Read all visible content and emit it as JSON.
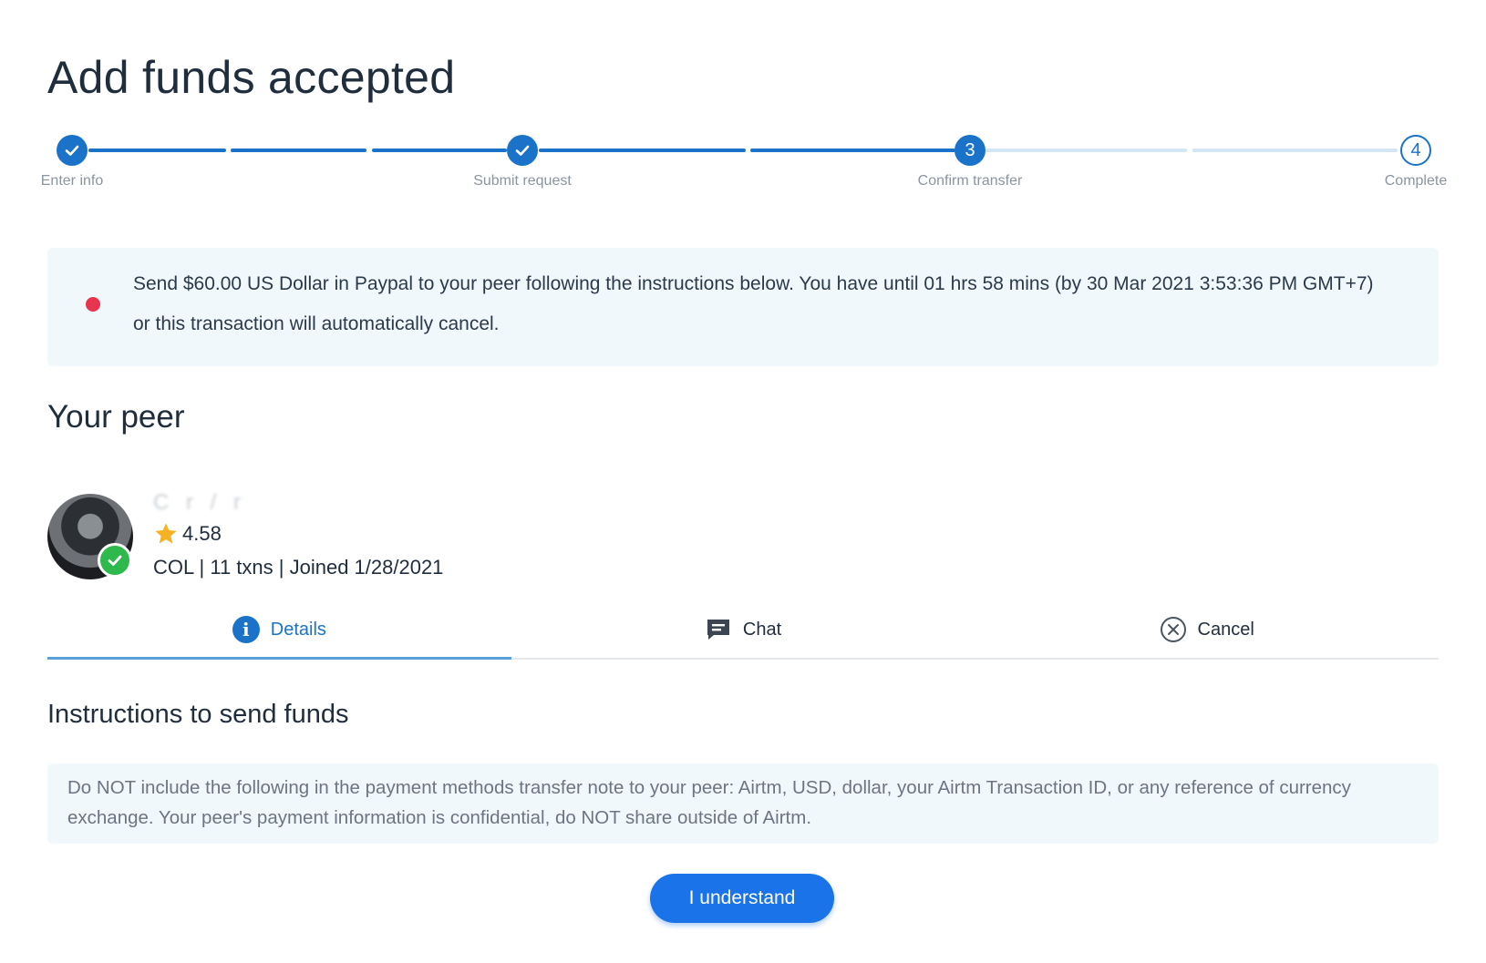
{
  "page": {
    "title": "Add funds accepted"
  },
  "stepper": {
    "steps": [
      {
        "label": "Enter info",
        "status": "done"
      },
      {
        "label": "Submit request",
        "status": "done"
      },
      {
        "label": "Confirm transfer",
        "status": "current",
        "number": "3"
      },
      {
        "label": "Complete",
        "status": "pending",
        "number": "4"
      }
    ]
  },
  "alert": {
    "text": "Send $60.00 US Dollar in Paypal to your peer following the instructions below. You have until 01 hrs 58 mins (by 30 Mar 2021 3:53:36 PM GMT+7) or this transaction will automatically cancel."
  },
  "peer": {
    "section_title": "Your peer",
    "name_redacted": "C r  / r ",
    "rating": "4.58",
    "meta": "COL | 11 txns | Joined 1/28/2021"
  },
  "tabs": [
    {
      "label": "Details",
      "icon": "info-icon",
      "active": true
    },
    {
      "label": "Chat",
      "icon": "chat-icon",
      "active": false
    },
    {
      "label": "Cancel",
      "icon": "cancel-circle-icon",
      "active": false
    }
  ],
  "instructions": {
    "title": "Instructions to send funds",
    "text": "Do NOT include the following in the payment methods transfer note to your peer: Airtm, USD, dollar, your Airtm Transaction ID, or any reference of currency exchange. Your peer's payment information is confidential, do NOT share outside of Airtm."
  },
  "actions": {
    "understand_label": "I understand"
  },
  "colors": {
    "accent": "#1a73c8",
    "alert_dot": "#e8344e",
    "verified": "#2fb84b",
    "star": "#f5b324"
  }
}
